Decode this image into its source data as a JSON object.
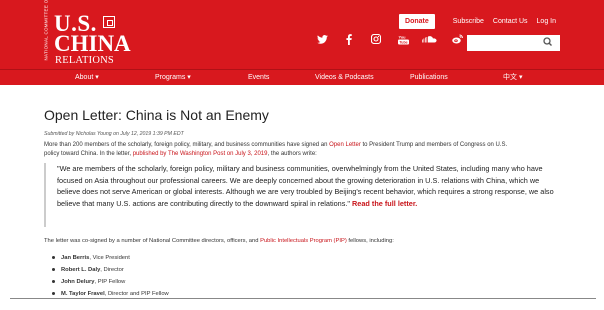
{
  "logo": {
    "side_text": "NATIONAL COMMITTEE ON",
    "us": "U.S.",
    "china": "CHINA",
    "relations": "RELATIONS"
  },
  "header_links": {
    "donate": "Donate",
    "subscribe": "Subscribe",
    "contact": "Contact Us",
    "login": "Log In"
  },
  "social_icons": [
    "twitter-icon",
    "facebook-icon",
    "instagram-icon",
    "youtube-icon",
    "soundcloud-icon",
    "weibo-icon"
  ],
  "search": {
    "placeholder": ""
  },
  "nav": {
    "items": [
      "About",
      "Programs",
      "Events",
      "Videos & Podcasts",
      "Publications",
      "中文"
    ]
  },
  "article": {
    "title": "Open Letter: China is Not an Enemy",
    "meta": "Submitted by Nicholas Young on July 12, 2019 1:39 PM EDT",
    "intro_p1": "More than 200 members of the scholarly, foreign policy, military, and business communities have signed an ",
    "intro_link1": "Open Letter",
    "intro_p2": " to President Trump and members of Congress on U.S.",
    "intro_p3": "policy toward China. In the letter, ",
    "intro_link2": "published by The Washington Post on July 3, 2019",
    "intro_p4": ", the authors write:",
    "quote": "\"We are members of the scholarly, foreign policy, military and business communities, overwhelmingly from the United States, including many who have focused on Asia throughout our professional careers. We are deeply concerned about the growing deterioration in U.S. relations with China, which we believe does not serve American or global interests. Although we are very troubled by Beijing's recent behavior, which requires a strong response, we also believe that many U.S. actions are contributing directly to the downward spiral in relations.\"",
    "read_full": "Read the full letter.",
    "cosign_p1": "The letter was co-signed by a number of National Committee directors, officers, and ",
    "cosign_link": "Public Intellectuals Program (PIP)",
    "cosign_p2": " fellows, including:",
    "signers": [
      {
        "name": "Jan Berris",
        "role": ", Vice President"
      },
      {
        "name": "Robert L. Daly",
        "role": ", Director"
      },
      {
        "name": "John Delury",
        "role": ", PIP Fellow"
      },
      {
        "name": "M. Taylor Fravel",
        "role": ", Director and PIP Fellow"
      }
    ]
  },
  "colors": {
    "brand_red": "#d8181e",
    "link_red": "#c8141a"
  }
}
